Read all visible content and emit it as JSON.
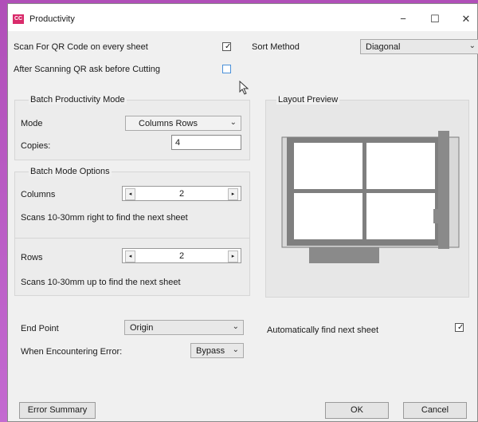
{
  "window": {
    "icon_text": "CC",
    "title": "Productivity",
    "minimize": "−",
    "maximize": "☐",
    "close": "✕"
  },
  "options": {
    "scan_qr_label": "Scan For QR Code on every sheet",
    "scan_qr_checked": true,
    "ask_before_cut_label": "After Scanning QR ask before Cutting",
    "ask_before_cut_checked": false,
    "sort_method_label": "Sort Method",
    "sort_method_value": "Diagonal"
  },
  "batch": {
    "title": "Batch Productivity Mode",
    "mode_label": "Mode",
    "mode_value": "Columns Rows",
    "copies_label": "Copies:",
    "copies_value": "4"
  },
  "batch_options": {
    "title": "Batch Mode Options",
    "columns_label": "Columns",
    "columns_value": "2",
    "columns_hint": "Scans 10-30mm right to find the next sheet",
    "rows_label": "Rows",
    "rows_value": "2",
    "rows_hint": "Scans 10-30mm up to find the next sheet",
    "arrow_left": "◂",
    "arrow_right": "▸"
  },
  "preview": {
    "title": "Layout Preview"
  },
  "bottom": {
    "end_point_label": "End Point",
    "end_point_value": "Origin",
    "error_label": "When Encountering Error:",
    "error_value": "Bypass",
    "auto_find_label": "Automatically find next sheet",
    "auto_find_checked": true
  },
  "buttons": {
    "error_summary": "Error Summary",
    "ok": "OK",
    "cancel": "Cancel"
  },
  "icons": {
    "chevron": "⌄",
    "check": "✓"
  }
}
